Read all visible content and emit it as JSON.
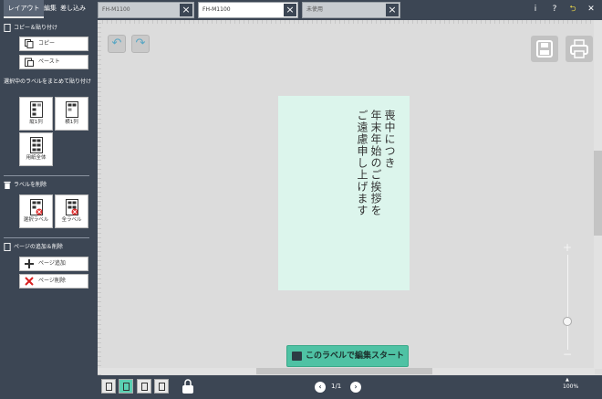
{
  "menus": [
    {
      "label": "レイアウト",
      "active": true
    },
    {
      "label": "編集",
      "active": false
    },
    {
      "label": "差し込み",
      "active": false
    }
  ],
  "doc_tabs": [
    {
      "label": "FH-M1100",
      "active": false
    },
    {
      "label": "FH-M1100",
      "active": true
    },
    {
      "label": "未使用",
      "active": false
    }
  ],
  "top_icons": [
    "info-icon",
    "help-icon",
    "restore-icon",
    "close-icon"
  ],
  "top_glyphs": {
    "info": "i",
    "help": "?",
    "restore": "⮌",
    "close": "✕"
  },
  "sidebar": {
    "copy_paste_title": "コピー＆貼り付け",
    "copy_label": "コピー",
    "paste_label": "ペースト",
    "bulk_paste_title": "選択中のラベルをまとめて貼り付け",
    "vertical_label": "縦1列",
    "horizontal_label": "横1列",
    "whole_sheet_label": "用紙全体",
    "delete_title": "ラベルを削除",
    "delete_selected_label": "選択ラベル",
    "delete_all_label": "全ラベル",
    "page_title": "ページの追加＆削除",
    "page_add_label": "ページ追加",
    "page_delete_label": "ページ削除"
  },
  "label_content": {
    "line1": "喪中につき",
    "line2": "年末年始のご挨拶を",
    "line3": "ご遠慮申し上げます"
  },
  "start_button": "このラベルで編集スタート",
  "pager": {
    "current": "1/1",
    "prev": "‹",
    "next": "›"
  },
  "zoom": {
    "value": "100%",
    "plus": "+",
    "minus": "−",
    "level": 0.3
  },
  "undo_glyph": "↶",
  "redo_glyph": "↷",
  "colors": {
    "sidebar": "#3c4654",
    "label_bg": "#dcf5ec",
    "accent": "#4fc2a4"
  }
}
